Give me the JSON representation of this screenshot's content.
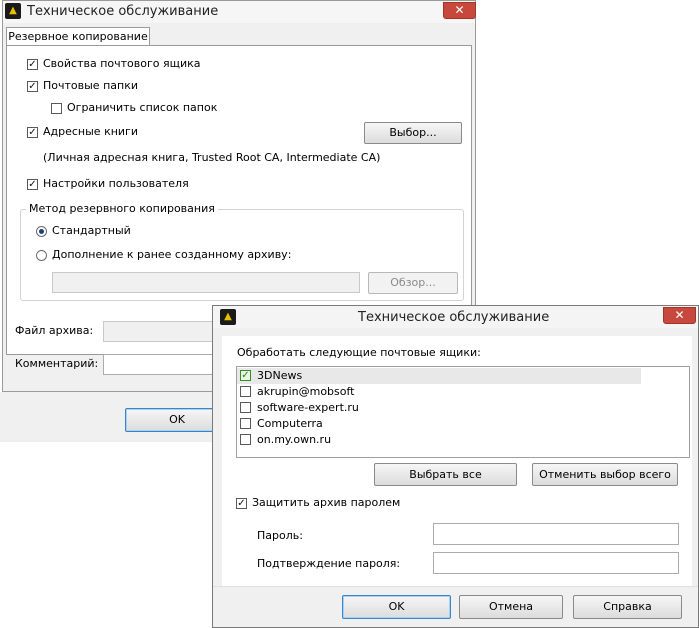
{
  "back_window": {
    "title": "Техническое обслуживание",
    "close_glyph": "✕",
    "tab_label": "Резервное копирование",
    "options": [
      {
        "label": "Свойства почтового ящика",
        "checked": true
      },
      {
        "label": "Почтовые папки",
        "checked": true
      },
      {
        "label": "Ограничить список папок",
        "checked": false
      },
      {
        "label": "Адресные книги",
        "checked": true
      },
      {
        "label": "Настройки пользователя",
        "checked": true
      }
    ],
    "address_books_note": "(Личная адресная книга, Trusted Root CA, Intermediate CA)",
    "select_button": "Выбор...",
    "method_group_title": "Метод резервного копирования",
    "method_standard": "Стандартный",
    "method_append": "Дополнение к ранее созданному архиву:",
    "browse_button": "Обзор...",
    "archive_file_label": "Файл архива:",
    "comment_label": "Комментарий:",
    "ok_button": "OK"
  },
  "front_window": {
    "title": "Техническое обслуживание",
    "close_glyph": "✕",
    "mailboxes_label": "Обработать следующие почтовые ящики:",
    "mailboxes": [
      {
        "name": "3DNews",
        "checked": true
      },
      {
        "name": "akrupin@mobsoft",
        "checked": false
      },
      {
        "name": "software-expert.ru",
        "checked": false
      },
      {
        "name": "Computerra",
        "checked": false
      },
      {
        "name": "on.my.own.ru",
        "checked": false
      }
    ],
    "select_all_button": "Выбрать все",
    "deselect_all_button": "Отменить выбор всего",
    "protect_label": "Защитить архив паролем",
    "protect_checked": true,
    "password_label": "Пароль:",
    "confirm_label": "Подтверждение пароля:",
    "ok_button": "OK",
    "cancel_button": "Отмена",
    "help_button": "Справка"
  },
  "colors": {
    "close_red": "#c7493d",
    "default_button_border": "#3a85c7",
    "window_bg": "#f0f0f0"
  }
}
